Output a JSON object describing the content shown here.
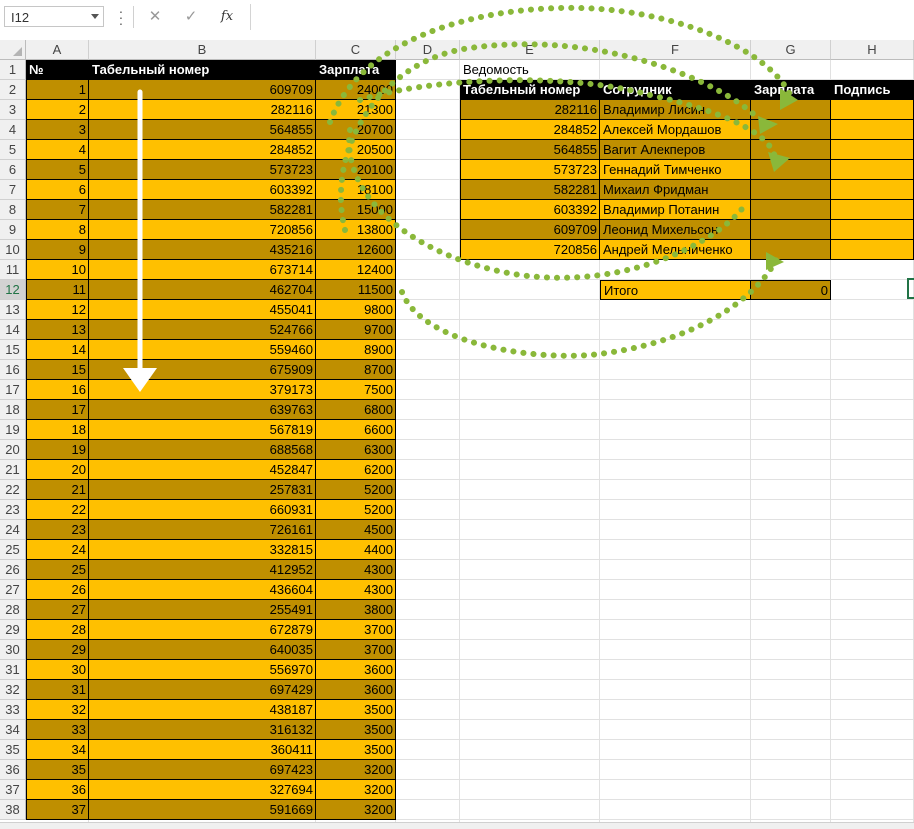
{
  "formula_bar": {
    "name_box": "I12",
    "cancel_glyph": "✕",
    "enter_glyph": "✓",
    "fx_label": "fx",
    "formula": ""
  },
  "columns": [
    "A",
    "B",
    "C",
    "D",
    "E",
    "F",
    "G",
    "H"
  ],
  "rows": [
    "1",
    "2",
    "3",
    "4",
    "5",
    "6",
    "7",
    "8",
    "9",
    "10",
    "11",
    "12",
    "13",
    "14",
    "15",
    "16",
    "17",
    "18",
    "19",
    "20",
    "21",
    "22",
    "23",
    "24",
    "25",
    "26",
    "27",
    "28",
    "29",
    "30",
    "31",
    "32",
    "33",
    "34",
    "35",
    "36",
    "37",
    "38"
  ],
  "left_table": {
    "headers": [
      "№",
      "Табельный номер",
      "Зарплата"
    ],
    "rows": [
      [
        1,
        609709,
        24000
      ],
      [
        2,
        282116,
        21300
      ],
      [
        3,
        564855,
        20700
      ],
      [
        4,
        284852,
        20500
      ],
      [
        5,
        573723,
        20100
      ],
      [
        6,
        603392,
        18100
      ],
      [
        7,
        582281,
        15000
      ],
      [
        8,
        720856,
        13800
      ],
      [
        9,
        435216,
        12600
      ],
      [
        10,
        673714,
        12400
      ],
      [
        11,
        462704,
        11500
      ],
      [
        12,
        455041,
        9800
      ],
      [
        13,
        524766,
        9700
      ],
      [
        14,
        559460,
        8900
      ],
      [
        15,
        675909,
        8700
      ],
      [
        16,
        379173,
        7500
      ],
      [
        17,
        639763,
        6800
      ],
      [
        18,
        567819,
        6600
      ],
      [
        19,
        688568,
        6300
      ],
      [
        20,
        452847,
        6200
      ],
      [
        21,
        257831,
        5200
      ],
      [
        22,
        660931,
        5200
      ],
      [
        23,
        726161,
        4500
      ],
      [
        24,
        332815,
        4400
      ],
      [
        25,
        412952,
        4300
      ],
      [
        26,
        436604,
        4300
      ],
      [
        27,
        255491,
        3800
      ],
      [
        28,
        672879,
        3700
      ],
      [
        29,
        640035,
        3700
      ],
      [
        30,
        556970,
        3600
      ],
      [
        31,
        697429,
        3600
      ],
      [
        32,
        438187,
        3500
      ],
      [
        33,
        316132,
        3500
      ],
      [
        34,
        360411,
        3500
      ],
      [
        35,
        697423,
        3200
      ],
      [
        36,
        327694,
        3200
      ],
      [
        37,
        591669,
        3200
      ]
    ]
  },
  "vedomost": {
    "title": "Ведомость",
    "headers": [
      "Табельный номер",
      "Сотрудник",
      "Зарплата",
      "Подпись"
    ],
    "rows": [
      [
        282116,
        "Владимир Лисин"
      ],
      [
        284852,
        "Алексей Мордашов"
      ],
      [
        564855,
        "Вагит Алекперов"
      ],
      [
        573723,
        "Геннадий Тимченко"
      ],
      [
        582281,
        "Михаил Фридман"
      ],
      [
        603392,
        "Владимир Потанин"
      ],
      [
        609709,
        "Леонид Михельсон"
      ],
      [
        720856,
        "Андрей Мельниченко"
      ]
    ],
    "total_label": "Итого",
    "total_value": 0
  },
  "colors": {
    "dark_fill": "#bf8f00",
    "light_fill": "#ffc000",
    "header_fill": "#000000",
    "arrow_green": "#8ab83a",
    "selection": "#217346"
  }
}
